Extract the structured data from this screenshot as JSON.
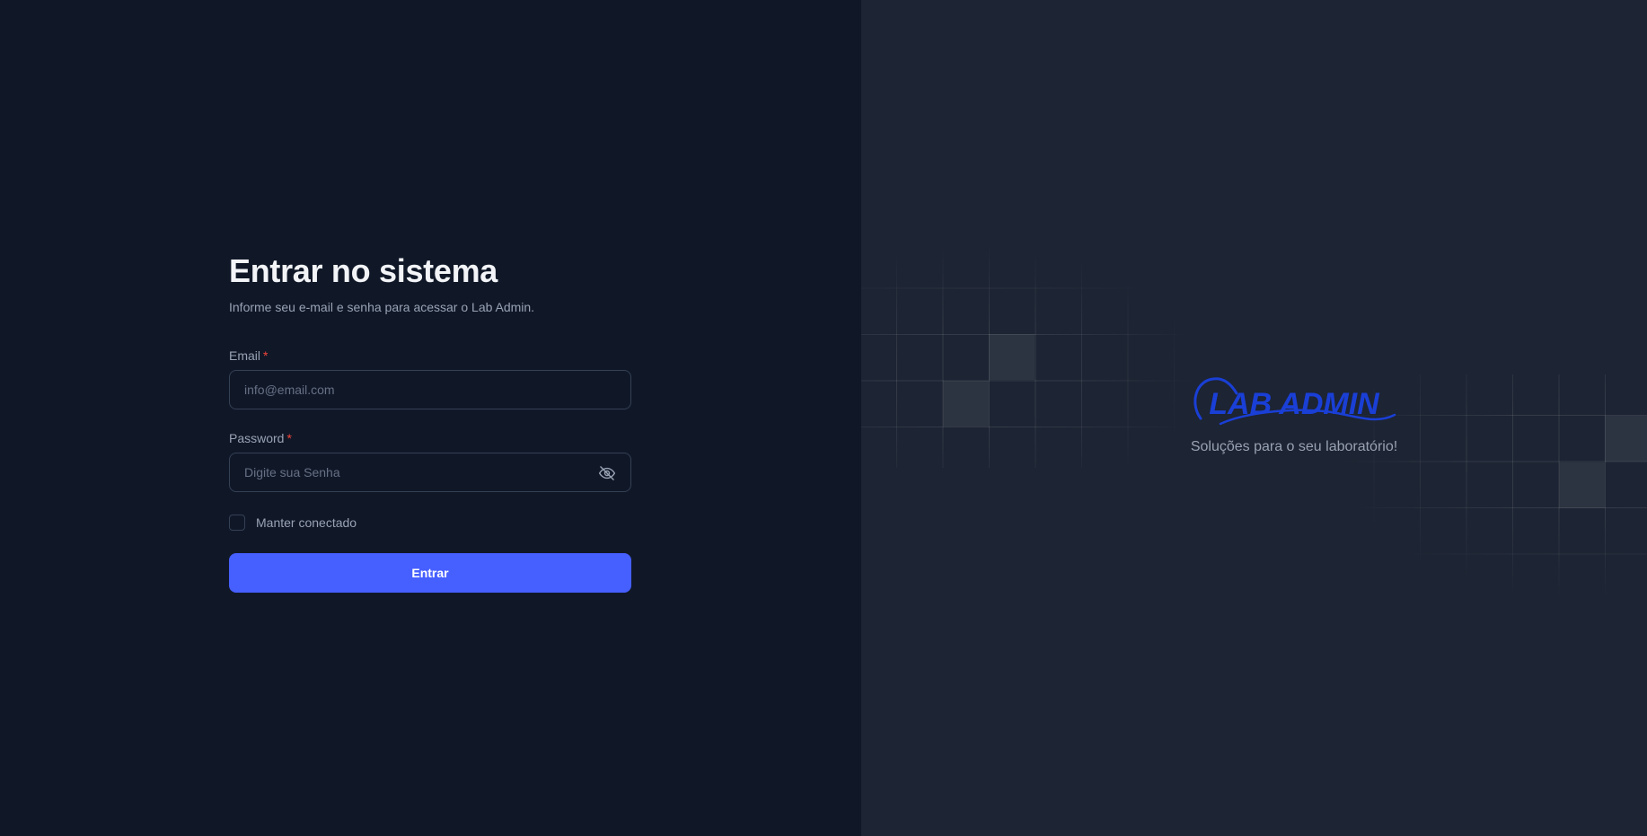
{
  "login": {
    "title": "Entrar no sistema",
    "subtitle": "Informe seu e-mail e senha para acessar o Lab Admin.",
    "email": {
      "label": "Email",
      "required_mark": "*",
      "placeholder": "info@email.com",
      "value": ""
    },
    "password": {
      "label": "Password",
      "required_mark": "*",
      "placeholder": "Digite sua Senha",
      "value": "",
      "toggle_icon": "eye-off-icon"
    },
    "remember": {
      "label": "Manter conectado",
      "checked": false
    },
    "submit_label": "Entrar"
  },
  "brand": {
    "logo_text": "LAB ADMIN",
    "tagline": "Soluções para o seu laboratório!"
  },
  "colors": {
    "left_background": "#101828",
    "right_background": "#1d2433",
    "accent": "#465fff",
    "logo": "#1a3fd6",
    "required": "#f04438"
  }
}
